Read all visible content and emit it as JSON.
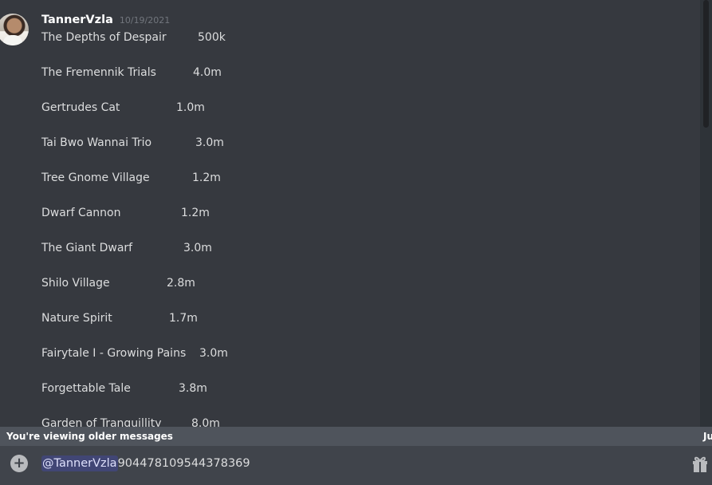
{
  "message": {
    "username": "TannerVzla",
    "timestamp": "10/19/2021",
    "quests": [
      {
        "name": "The Depths of Despair",
        "value": "500k"
      },
      {
        "name": "The Fremennik Trials",
        "value": "4.0m"
      },
      {
        "name": "Gertrudes Cat",
        "value": "1.0m"
      },
      {
        "name": "Tai Bwo Wannai Trio",
        "value": "3.0m"
      },
      {
        "name": "Tree Gnome Village",
        "value": "1.2m"
      },
      {
        "name": "Dwarf Cannon",
        "value": "1.2m"
      },
      {
        "name": "The Giant Dwarf",
        "value": "3.0m"
      },
      {
        "name": "Shilo Village",
        "value": "2.8m"
      },
      {
        "name": "Nature Spirit",
        "value": "1.7m"
      },
      {
        "name": "Fairytale I - Growing Pains",
        "value": "3.0m"
      },
      {
        "name": "Forgettable Tale",
        "value": "3.8m"
      },
      {
        "name": "Garden of Tranquillity",
        "value": "8.0m"
      }
    ]
  },
  "older_bar": {
    "text": "You're viewing older messages",
    "jump_label": "Ju"
  },
  "composer": {
    "mention": "@TannerVzla",
    "text": "904478109544378369"
  },
  "icons": {
    "add": "plus-circle-icon",
    "gift": "gift-icon"
  },
  "colors": {
    "background": "#36393f",
    "composer": "#40444b",
    "older_bar": "#4f545c",
    "mention_bg": "#414675",
    "mention_text": "#dee0fc"
  }
}
